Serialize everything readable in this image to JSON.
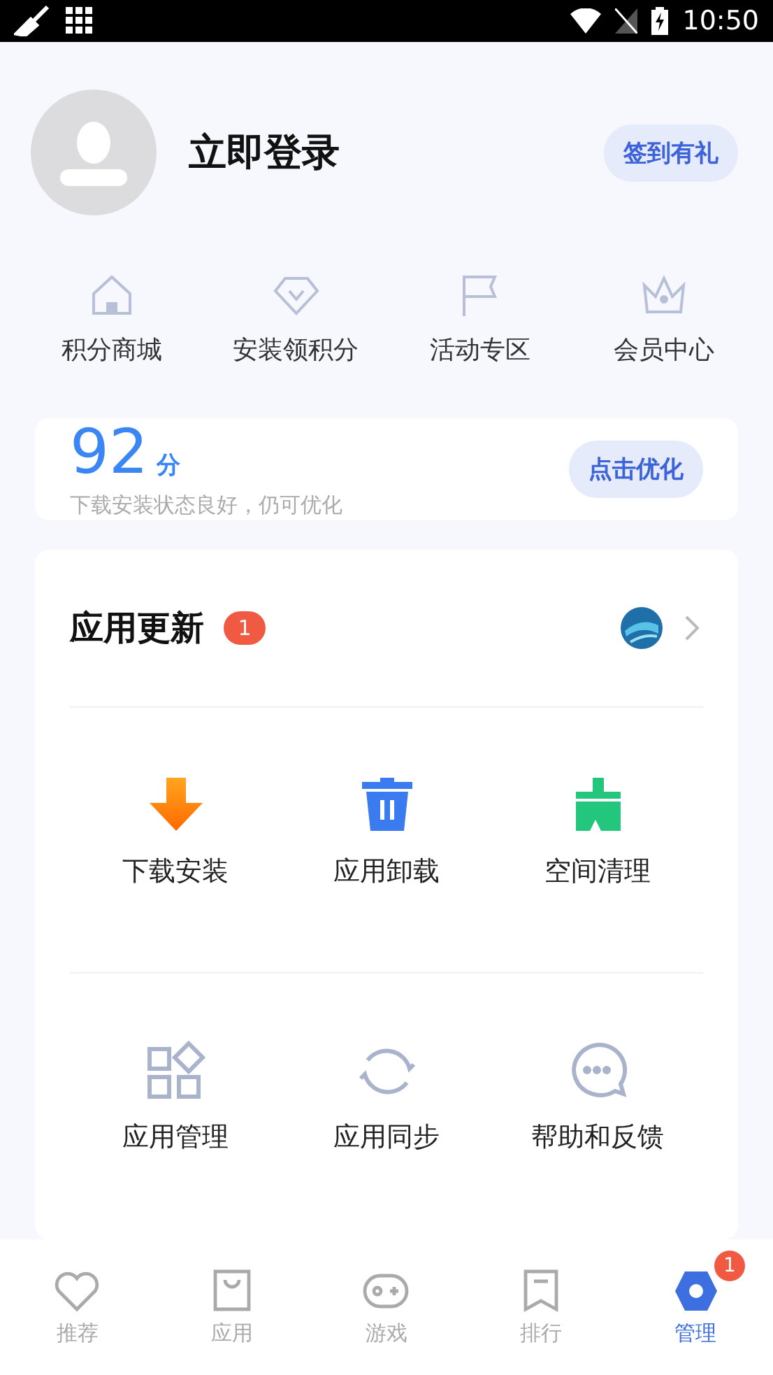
{
  "status_bar": {
    "time": "10:50"
  },
  "profile": {
    "login_label": "立即登录",
    "signin_button": "签到有礼"
  },
  "shortcuts": [
    {
      "kind": "house",
      "label": "积分商城"
    },
    {
      "kind": "gem",
      "label": "安装领积分"
    },
    {
      "kind": "flag",
      "label": "活动专区"
    },
    {
      "kind": "crown",
      "label": "会员中心"
    }
  ],
  "score": {
    "value": "92",
    "unit": "分",
    "description": "下载安装状态良好，仍可优化",
    "button": "点击优化"
  },
  "updates": {
    "title": "应用更新",
    "badge": "1"
  },
  "tools": [
    {
      "kind": "download",
      "label": "下载安装"
    },
    {
      "kind": "trash",
      "label": "应用卸载"
    },
    {
      "kind": "broom",
      "label": "空间清理"
    },
    {
      "kind": "grid",
      "label": "应用管理"
    },
    {
      "kind": "sync",
      "label": "应用同步"
    },
    {
      "kind": "chat",
      "label": "帮助和反馈"
    }
  ],
  "nav": [
    {
      "kind": "heart",
      "label": "推荐",
      "selected": false
    },
    {
      "kind": "bag",
      "label": "应用",
      "selected": false
    },
    {
      "kind": "gamepad",
      "label": "游戏",
      "selected": false
    },
    {
      "kind": "list",
      "label": "排行",
      "selected": false
    },
    {
      "kind": "manage",
      "label": "管理",
      "selected": true,
      "badge": "1"
    }
  ]
}
